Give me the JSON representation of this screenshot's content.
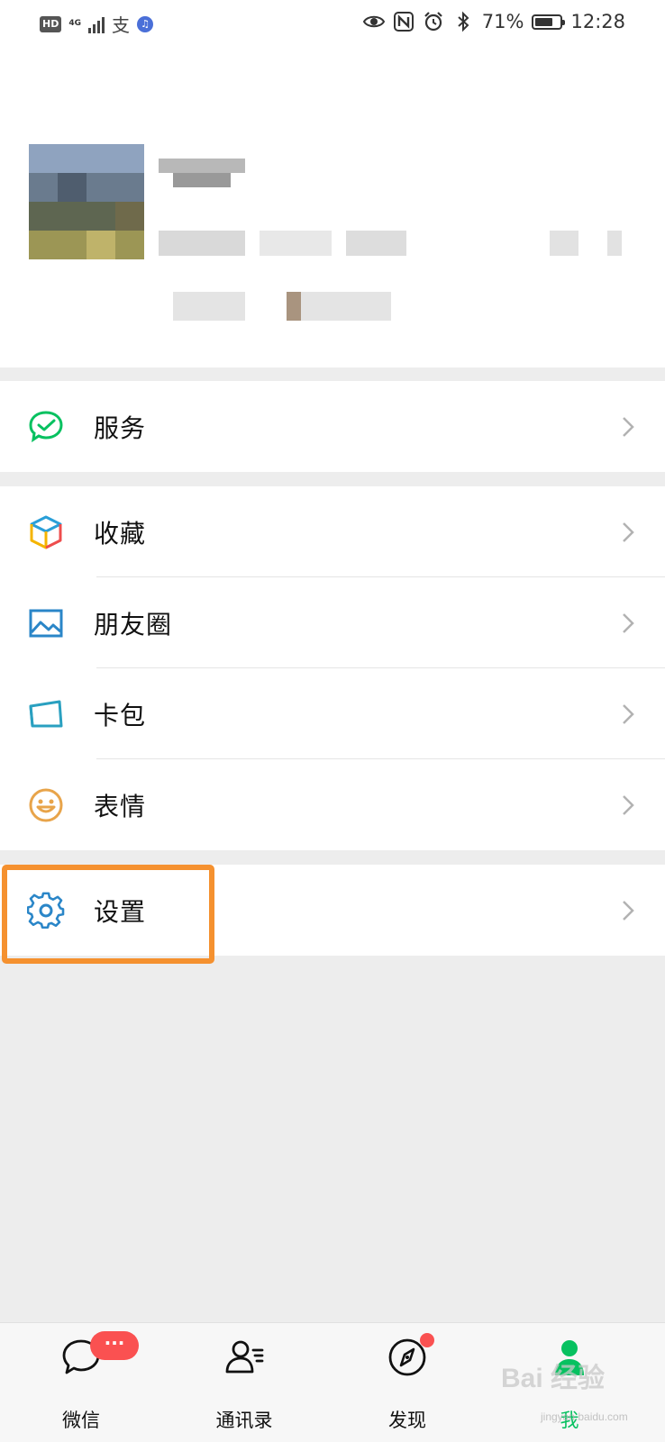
{
  "status_bar": {
    "hd": "HD",
    "network": "4G",
    "alipay_glyph": "支",
    "music_glyph": "♫",
    "battery_percent": "71%",
    "battery_level": 0.71,
    "time": "12:28",
    "icons": [
      "eye-icon",
      "nfc-icon",
      "alarm-icon",
      "bluetooth-icon",
      "battery-icon"
    ]
  },
  "menu": {
    "group1": [
      {
        "label": "服务",
        "icon": "wechat-pay-icon"
      }
    ],
    "group2": [
      {
        "label": "收藏",
        "icon": "favorites-cube-icon"
      },
      {
        "label": "朋友圈",
        "icon": "moments-photo-icon"
      },
      {
        "label": "卡包",
        "icon": "card-wallet-icon"
      },
      {
        "label": "表情",
        "icon": "smiley-icon"
      }
    ],
    "group3": [
      {
        "label": "设置",
        "icon": "gear-icon"
      }
    ]
  },
  "tabbar": {
    "tabs": [
      {
        "label": "微信",
        "icon": "chat-bubble-icon"
      },
      {
        "label": "通讯录",
        "icon": "contacts-icon"
      },
      {
        "label": "发现",
        "icon": "compass-icon"
      },
      {
        "label": "我",
        "icon": "person-icon"
      }
    ],
    "chat_badge": "···",
    "active_tab": "我"
  },
  "colors": {
    "accent": "#07c160",
    "badge": "#fa5151",
    "highlight": "#f5912f",
    "background": "#ededed"
  },
  "watermark": {
    "text": "Bai 经验",
    "sub": "jingyan.baidu.com"
  }
}
